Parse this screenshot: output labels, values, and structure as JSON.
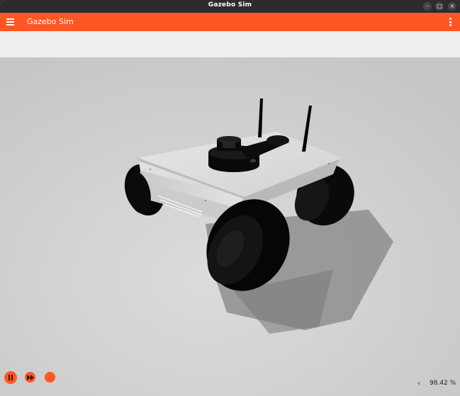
{
  "window": {
    "title": "Gazebo Sim",
    "controls": {
      "minimize": "minimize-icon",
      "maximize": "maximize-icon",
      "close": "close-icon"
    }
  },
  "appbar": {
    "title": "Gazebo Sim",
    "menu_icon": "hamburger-menu-icon",
    "options_icon": "kebab-menu-icon",
    "accent_color": "#ff5722"
  },
  "scene": {
    "description_icon": "robot-model"
  },
  "controls": {
    "play_pause_icon": "pause-icon",
    "step_icon": "fast-forward-icon",
    "rtf_toggle": "‹",
    "rtf_value": "98.42 %"
  }
}
